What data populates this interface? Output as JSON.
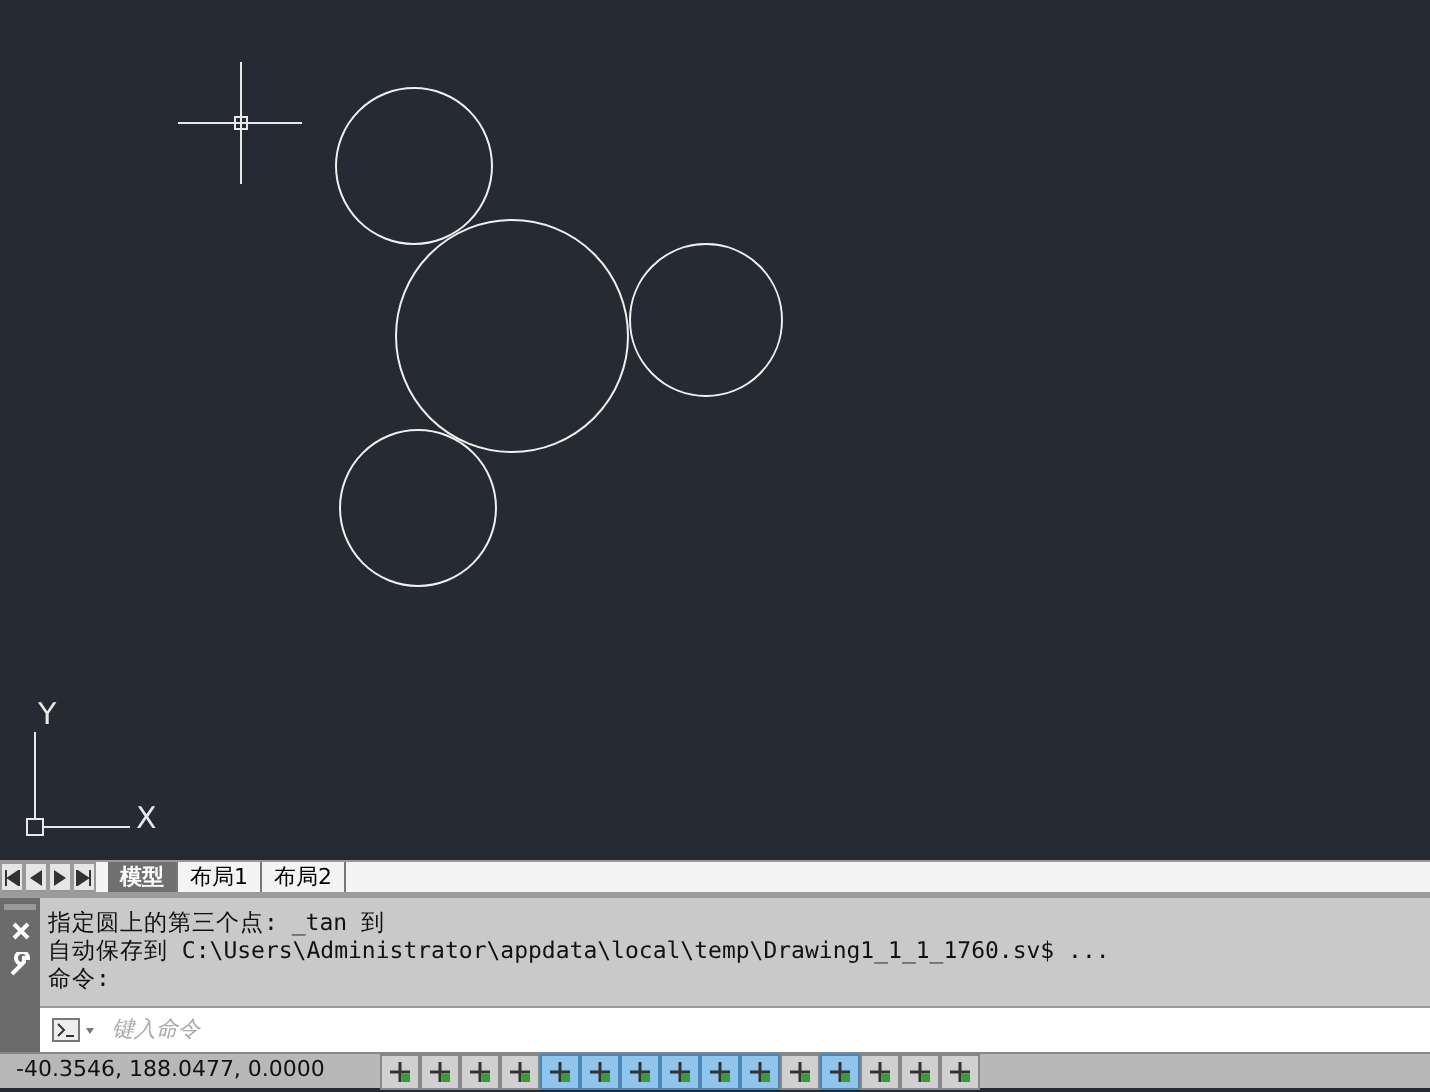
{
  "drawing_area": {
    "ucs_labels": {
      "y": "Y",
      "x": "X"
    }
  },
  "layout_tabs": [
    {
      "label": "模型",
      "selected": true
    },
    {
      "label": "布局1",
      "selected": false
    },
    {
      "label": "布局2",
      "selected": false
    }
  ],
  "command_history": [
    "指定圆上的第三个点: _tan 到",
    "自动保存到 C:\\Users\\Administrator\\appdata\\local\\temp\\Drawing1_1_1_1760.sv$ ...",
    "命令:"
  ],
  "command_input": {
    "placeholder": "键入命令"
  },
  "status_bar": {
    "coordinates": "-40.3546, 188.0477, 0.0000",
    "toggles": [
      {
        "on": false
      },
      {
        "on": false
      },
      {
        "on": false
      },
      {
        "on": false
      },
      {
        "on": true
      },
      {
        "on": true
      },
      {
        "on": true
      },
      {
        "on": true
      },
      {
        "on": true
      },
      {
        "on": true
      },
      {
        "on": false
      },
      {
        "on": true
      },
      {
        "on": false
      },
      {
        "on": false
      },
      {
        "on": false
      }
    ]
  }
}
